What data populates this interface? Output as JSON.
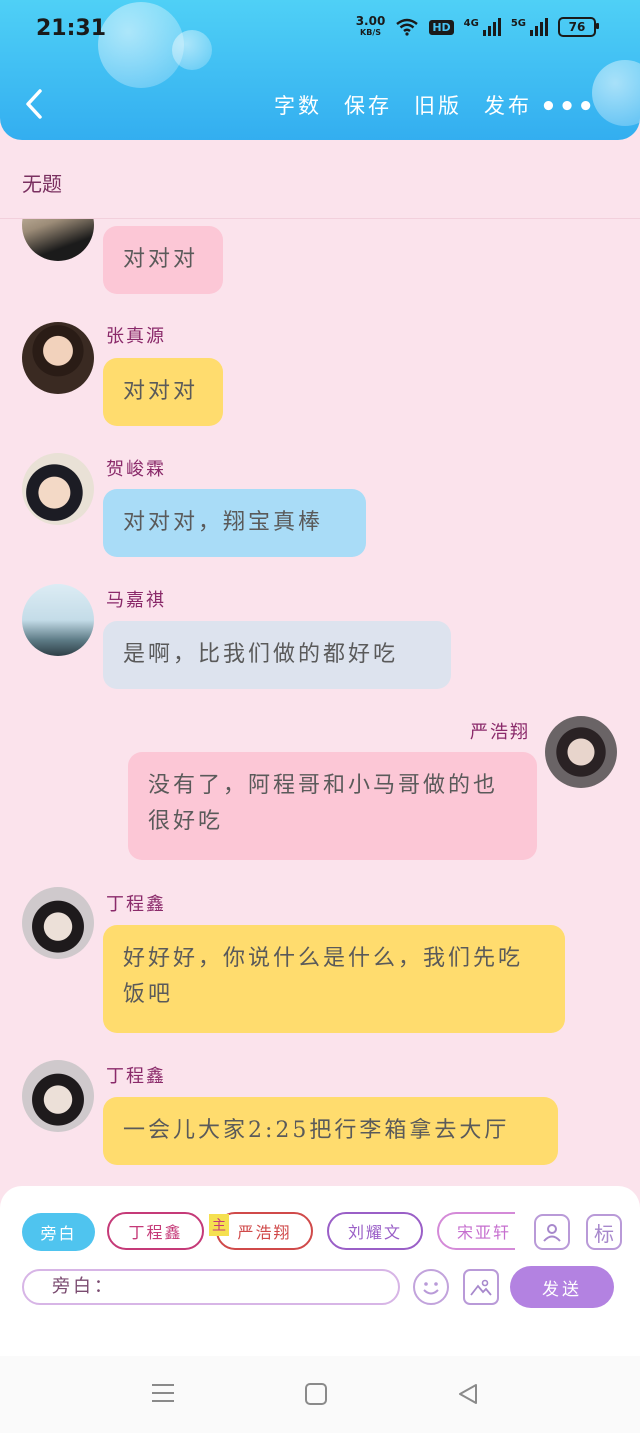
{
  "status_bar": {
    "time": "21:31",
    "net_speed": "3.00",
    "net_unit": "KB/S",
    "hd": "HD",
    "net_4g": "4G",
    "net_5g": "5G",
    "battery": "76"
  },
  "header": {
    "actions": [
      "字数",
      "保存",
      "旧版",
      "发布"
    ],
    "more": "•••",
    "colors": {
      "gradient_top": "#4fd0f6",
      "gradient_bottom": "#33aef0"
    }
  },
  "doc_title": "无题",
  "messages": [
    {
      "sender": "",
      "text": "对对对",
      "color": "pink",
      "side": "left",
      "avatar_icon": "avatar-top-partial"
    },
    {
      "sender": "张真源",
      "text": "对对对",
      "color": "yellow",
      "side": "left"
    },
    {
      "sender": "贺峻霖",
      "text": "对对对，翔宝真棒",
      "color": "blue",
      "side": "left"
    },
    {
      "sender": "马嘉祺",
      "text": "是啊，比我们做的都好吃",
      "color": "grey",
      "side": "left"
    },
    {
      "sender": "严浩翔",
      "text": "没有了，阿程哥和小马哥做的也很好吃",
      "color": "pink",
      "side": "right"
    },
    {
      "sender": "丁程鑫",
      "text": "好好好，你说什么是什么，我们先吃饭吧",
      "color": "yellow",
      "side": "left"
    },
    {
      "sender": "丁程鑫",
      "text": "一会儿大家2:25把行李箱拿去大厅",
      "color": "yellow",
      "side": "left"
    }
  ],
  "panel": {
    "chips": [
      "旁白",
      "丁程鑫",
      "严浩翔",
      "刘耀文",
      "宋亚轩"
    ],
    "main_badge": "主",
    "tag_button": "标",
    "input_value": "旁白：",
    "send_label": "发送"
  },
  "nav": {
    "menu_icon": "≡",
    "home_icon": "□",
    "back_icon": "◁"
  }
}
